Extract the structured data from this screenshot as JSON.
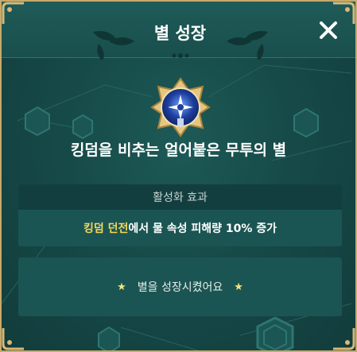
{
  "dialog": {
    "title": "별 성장",
    "close_icon": "close-icon"
  },
  "star": {
    "name": "킹덤을 비추는 얼어붙은 무투의 별",
    "emblem_icon": "compass-star-emblem-icon"
  },
  "effect": {
    "header": "활성화 효과",
    "highlight": "킹덤 던전",
    "text": "에서 물 속성 피해량 10% 증가"
  },
  "status": {
    "message": "별을 성장시켰어요",
    "star_icon": "★"
  },
  "colors": {
    "background": "#164a48",
    "frame_gold": "#c9a968",
    "highlight_yellow": "#f5d65b",
    "box_bg": "#1a5553"
  }
}
